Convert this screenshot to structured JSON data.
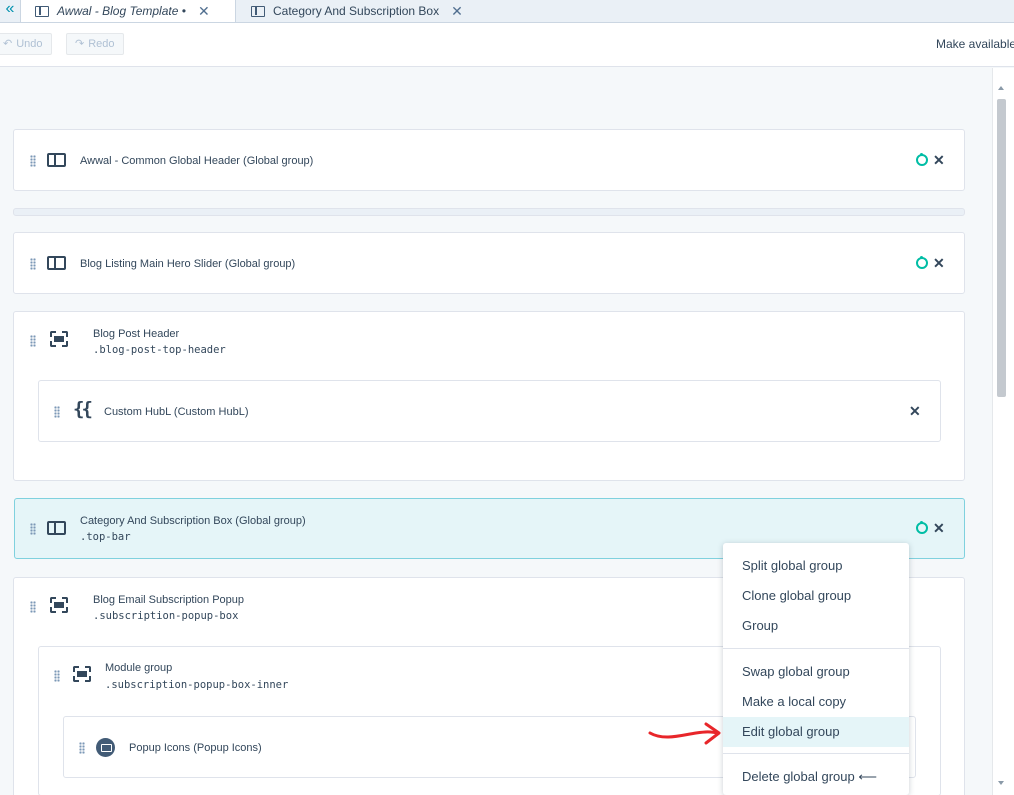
{
  "tabs": {
    "collapse_glyph": "«",
    "items": [
      {
        "label": "Awwal - Blog Template •",
        "italic": true,
        "icon": "doc-template-icon"
      },
      {
        "label": "Category And Subscription Box",
        "italic": false,
        "icon": "layout-icon"
      }
    ],
    "close_glyph": "✕"
  },
  "toolbar": {
    "undo_label": "Undo",
    "redo_label": "Redo",
    "undo_glyph": "↶",
    "redo_glyph": "↷",
    "make_available": "Make available"
  },
  "modules": [
    {
      "title": "Awwal - Common Global Header (Global group)",
      "icon": "layout-icon",
      "actions": [
        "globe-icon",
        "unpin-icon"
      ]
    },
    {
      "title": "Blog Listing Main Hero Slider (Global group)",
      "icon": "layout-icon",
      "actions": [
        "globe-icon",
        "unpin-icon"
      ]
    },
    {
      "title": "Blog Post Header",
      "class": ".blog-post-top-header",
      "icon": "group-icon"
    },
    {
      "title": "Custom HubL (Custom HubL)",
      "icon": "hubl-icon",
      "icon_text": "{{",
      "actions": [
        "unpin-icon"
      ]
    },
    {
      "title": "Category And Subscription Box (Global group)",
      "class": ".top-bar",
      "icon": "layout-icon",
      "selected": true,
      "actions": [
        "globe-icon",
        "unpin-icon"
      ]
    },
    {
      "title": "Blog Email Subscription Popup",
      "class": ".subscription-popup-box",
      "icon": "group-icon"
    },
    {
      "title": "Module group",
      "class": ".subscription-popup-box-inner",
      "icon": "group-icon"
    },
    {
      "title": "Popup Icons (Popup Icons)",
      "icon": "mail-icon"
    }
  ],
  "context_menu": {
    "items": [
      {
        "label": "Split global group"
      },
      {
        "label": "Clone global group"
      },
      {
        "label": "Group"
      },
      {
        "label": "Swap global group"
      },
      {
        "label": "Make a local copy"
      },
      {
        "label": "Edit global group",
        "highlighted": true
      },
      {
        "label": "Delete global group ⟵"
      }
    ]
  },
  "annotation": {
    "color": "#e8262a",
    "icon": "red-arrow-annotation"
  }
}
